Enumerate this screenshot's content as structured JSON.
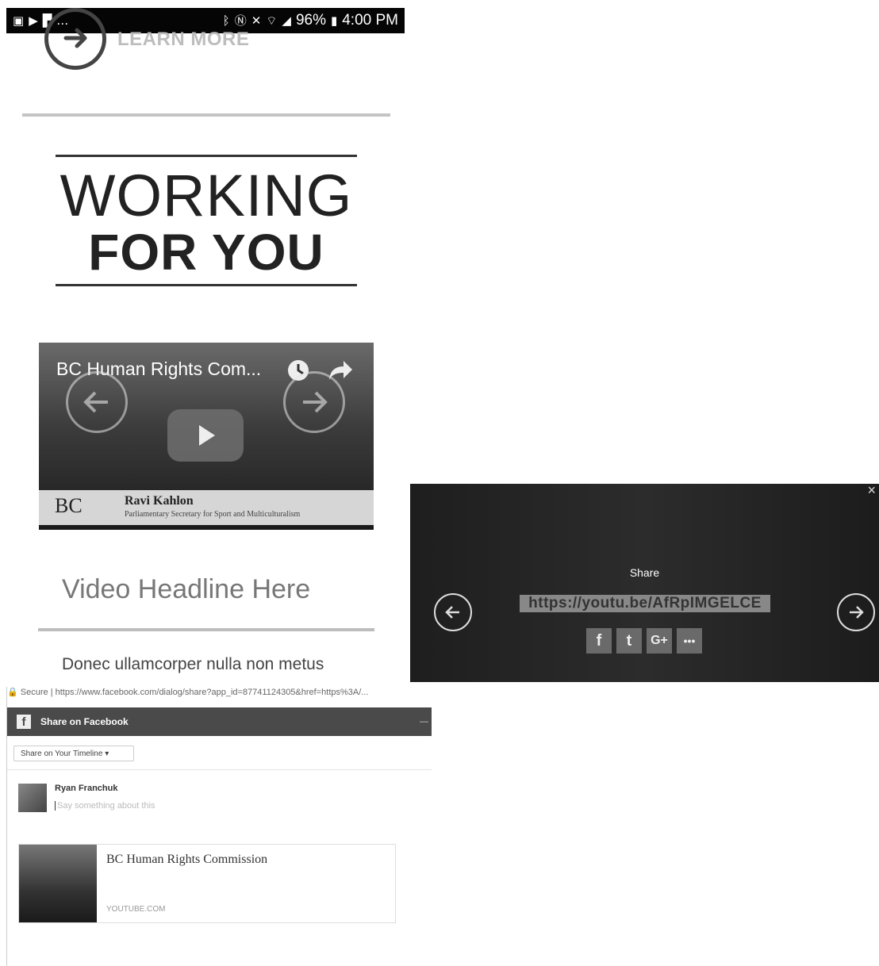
{
  "status_bar": {
    "battery": "96%",
    "time": "4:00 PM",
    "left_icons": [
      "gallery-icon",
      "play-store-icon",
      "flipboard-icon",
      "more-icon"
    ],
    "right_icons": [
      "bluetooth-icon",
      "nfc-icon",
      "mute-icon",
      "wifi-icon",
      "signal-icon",
      "battery-icon"
    ]
  },
  "learn_more": {
    "label": "LEARN MORE",
    "icon": "arrow-right-circle-icon"
  },
  "banner": {
    "line1": "WORKING",
    "line2": "FOR YOU"
  },
  "video": {
    "title": "BC Human Rights Com...",
    "lower_third_logo": "BC",
    "lower_third_name": "Ravi Kahlon",
    "lower_third_role": "Parliamentary Secretary for Sport and Multiculturalism",
    "icons": [
      "watch-later-icon",
      "share-icon",
      "play-icon",
      "prev-arrow-icon",
      "next-arrow-icon"
    ]
  },
  "video_headline": "Video Headline Here",
  "body_text": "Donec ullamcorper nulla non metus",
  "share_overlay": {
    "title": "Share",
    "url": "https://youtu.be/AfRpIMGELCE",
    "buttons": [
      {
        "name": "facebook",
        "glyph": "f"
      },
      {
        "name": "twitter",
        "glyph": "t"
      },
      {
        "name": "google-plus",
        "glyph": "G+"
      },
      {
        "name": "more",
        "glyph": "•••"
      }
    ],
    "close_glyph": "×"
  },
  "facebook_dialog": {
    "secure_label": "Secure",
    "address": "https://www.facebook.com/dialog/share?app_id=87741124305&href=https%3A/...",
    "header_title": "Share on Facebook",
    "audience_select": "Share on Your Timeline",
    "user_name": "Ryan Franchuk",
    "say_placeholder": "Say something about this",
    "card_title": "BC Human Rights Commission",
    "card_domain": "YOUTUBE.COM"
  },
  "colors": {
    "dark": "#050505",
    "fb_header": "#4a4a4a",
    "text_grey": "#777777"
  }
}
